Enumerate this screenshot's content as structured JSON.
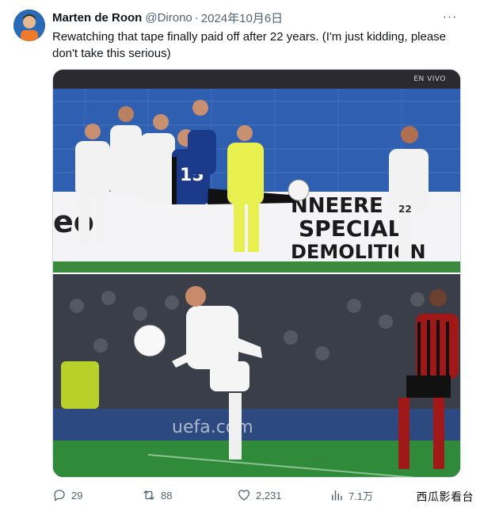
{
  "tweet": {
    "author_name": "Marten de Roon",
    "author_handle": "@Dirono",
    "separator": "·",
    "date": "2024年10月6日",
    "more_label": "···",
    "text": "Rewatching that tape finally paid off after 22 years. (I'm just kidding, please don't take this serious)"
  },
  "media": {
    "top_photo_overlay": "EN VIVO",
    "top_photo_ad_lines": [
      "NNEERE",
      "SPECIAL",
      "DEMOLITION"
    ],
    "top_photo_jersey": "15",
    "top_photo_jersey_2": "22",
    "bottom_photo_ad": "uefa.com"
  },
  "actions": {
    "replies": "29",
    "retweets": "88",
    "likes": "2,231",
    "views": "7.1万"
  },
  "watermark": "西瓜影看台",
  "colors": {
    "text": "#0f1419",
    "muted": "#536471",
    "border": "#cfd9de",
    "inter_blue": "#1b3a8a",
    "pitch_green": "#2f8a3a"
  },
  "icons": {
    "reply": "reply-icon",
    "retweet": "retweet-icon",
    "like": "heart-icon",
    "views": "views-chart-icon",
    "more": "more-dots-icon"
  }
}
